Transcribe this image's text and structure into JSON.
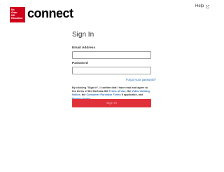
{
  "header": {
    "logo_text": "Mc\nGraw\nHill\nEducation",
    "brand": "connect",
    "help_label": "Help"
  },
  "form": {
    "title": "Sign In",
    "email_label": "Email Address",
    "email_value": "",
    "password_label": "Password",
    "password_value": "",
    "forgot_link": "Forgot your password?",
    "terms": {
      "prefix": "By clicking \"Sign In\", I confirm that I have read and agree to the terms of the McGraw-Hill ",
      "tou": "Terms of Use",
      "mid1": ", the ",
      "vpn": "Video Viewing Notice",
      "mid2": ", the ",
      "cpt": "Consumer Purchase Terms",
      "mid3": " if applicable, and ",
      "privacy": "Privacy Notice",
      "suffix": "."
    },
    "submit_label": "Sign In"
  },
  "colors": {
    "brand_red": "#d0021b",
    "button_red": "#e0313a",
    "link_blue": "#2a6ebb"
  }
}
